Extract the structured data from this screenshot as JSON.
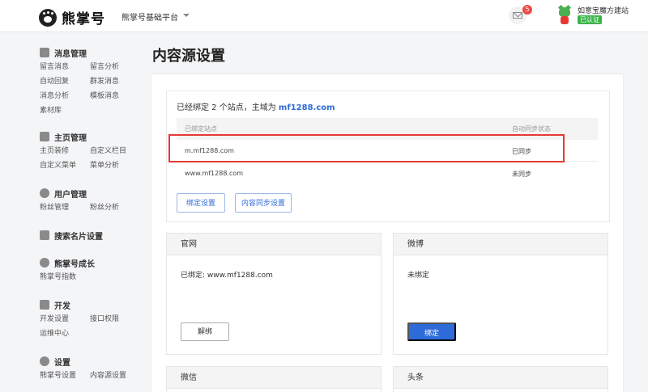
{
  "header": {
    "logo_text": "熊掌号",
    "platform": "熊掌号基础平台",
    "mail_badge": "5",
    "account_name": "如意宝魔方建站",
    "verified": "已认证"
  },
  "sidebar": {
    "groups": [
      {
        "title": "消息管理",
        "icon": "message-icon",
        "items": [
          "留言消息",
          "留言分析",
          "自动回复",
          "群发消息",
          "消息分析",
          "模板消息",
          "素材库"
        ]
      },
      {
        "title": "主页管理",
        "icon": "home-grid-icon",
        "items": [
          "主页装修",
          "自定义栏目",
          "自定义菜单",
          "菜单分析"
        ]
      },
      {
        "title": "用户管理",
        "icon": "user-icon",
        "items": [
          "粉丝管理",
          "粉丝分析"
        ]
      },
      {
        "title": "搜索名片设置",
        "icon": "card-icon",
        "items": []
      },
      {
        "title": "熊掌号成长",
        "icon": "growth-icon",
        "items": [
          "熊掌号指数"
        ]
      },
      {
        "title": "开发",
        "icon": "code-icon",
        "items": [
          "开发设置",
          "接口权限",
          "运维中心"
        ]
      },
      {
        "title": "设置",
        "icon": "settings-icon",
        "items": [
          "熊掌号设置",
          "内容源设置"
        ]
      }
    ]
  },
  "main": {
    "title": "内容源设置",
    "sites": {
      "summary_prefix": "已经绑定 2 个站点，主域为",
      "domain": "mf1288.com",
      "col_site": "已绑定站点",
      "col_sync": "自动同步状态",
      "rows": [
        {
          "site": "m.mf1288.com",
          "status": "已同步"
        },
        {
          "site": "www.mf1288.com",
          "status": "未同步"
        }
      ],
      "btn_bind_settings": "绑定设置",
      "btn_sync_settings": "内容同步设置"
    },
    "cards": {
      "website": {
        "title": "官网",
        "text": "已绑定: www.mf1288.com",
        "button": "解绑"
      },
      "weibo": {
        "title": "微博",
        "text": "未绑定",
        "button": "绑定"
      },
      "wechat": {
        "title": "微信"
      },
      "toutiao": {
        "title": "头条"
      }
    }
  }
}
